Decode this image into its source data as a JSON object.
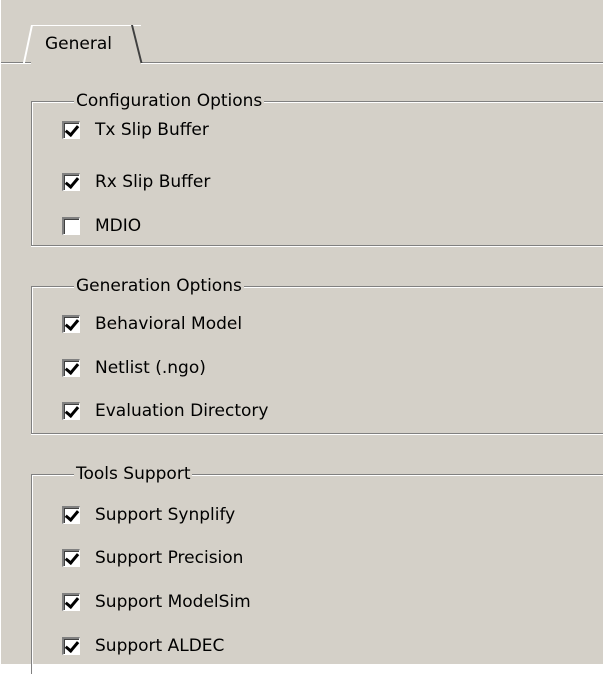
{
  "tabs": [
    {
      "label": "General",
      "active": true
    }
  ],
  "groups": [
    {
      "title": "Configuration Options",
      "options": [
        {
          "label": "Tx Slip Buffer",
          "checked": true
        },
        {
          "label": "Rx Slip Buffer",
          "checked": true
        },
        {
          "label": "MDIO",
          "checked": false
        }
      ]
    },
    {
      "title": "Generation Options",
      "options": [
        {
          "label": "Behavioral Model",
          "checked": true
        },
        {
          "label": "Netlist (.ngo)",
          "checked": true
        },
        {
          "label": "Evaluation Directory",
          "checked": true
        }
      ]
    },
    {
      "title": "Tools Support",
      "options": [
        {
          "label": "Support Synplify",
          "checked": true
        },
        {
          "label": "Support Precision",
          "checked": true
        },
        {
          "label": "Support ModelSim",
          "checked": true
        },
        {
          "label": "Support ALDEC",
          "checked": true
        }
      ]
    }
  ],
  "colors": {
    "panel_background": "#d4d0c8",
    "shadow": "#808080",
    "highlight": "#ffffff",
    "checkbox_background": "#ffffff",
    "check_mark": "#000000"
  }
}
